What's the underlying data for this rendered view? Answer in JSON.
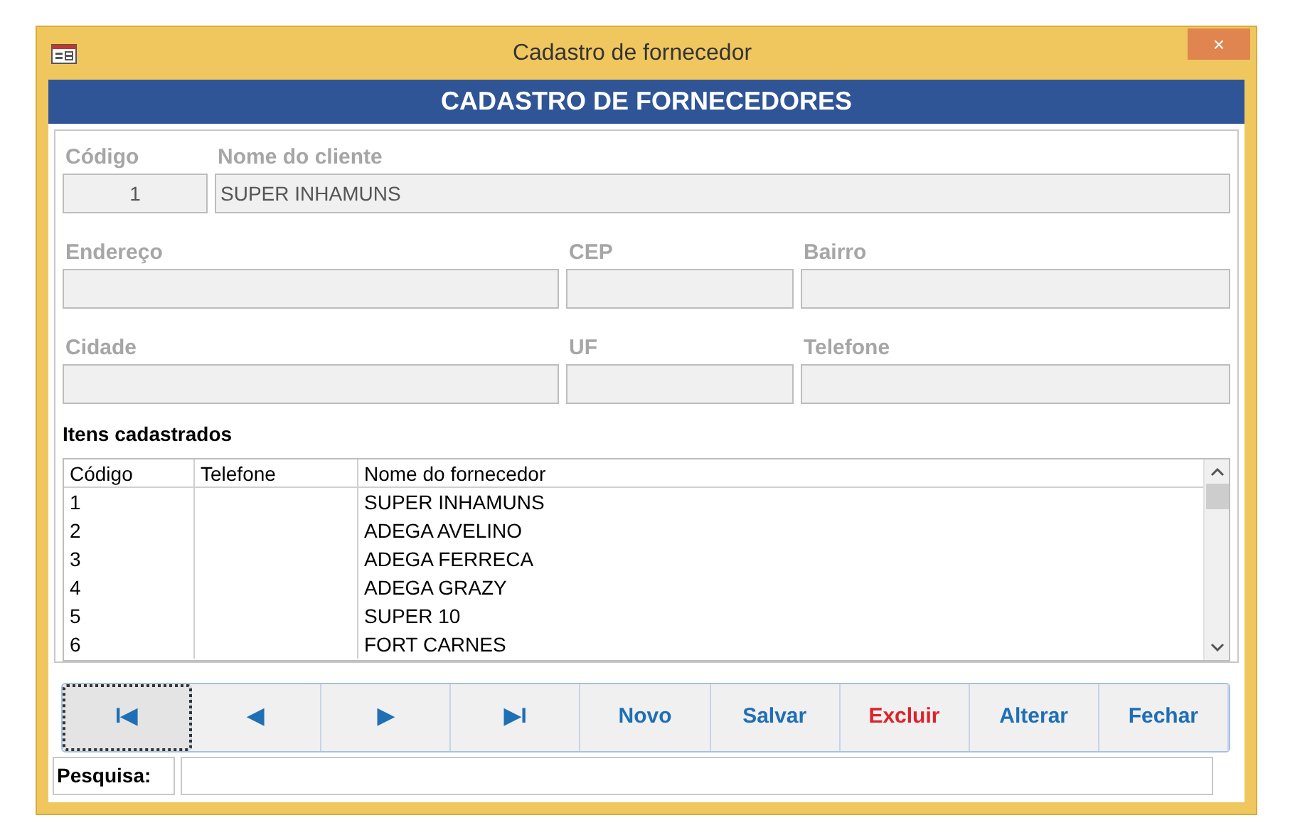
{
  "window": {
    "title": "Cadastro de fornecedor",
    "close": "×"
  },
  "header": "CADASTRO DE FORNECEDORES",
  "form": {
    "rows": [
      [
        {
          "label": "Código",
          "value": "1"
        },
        {
          "label": "Nome do cliente",
          "value": "SUPER INHAMUNS"
        }
      ],
      [
        {
          "label": "Endereço"
        },
        {
          "label": "CEP"
        },
        {
          "label": "Bairro"
        }
      ],
      [
        {
          "label": "Cidade"
        },
        {
          "label": "UF"
        },
        {
          "label": "Telefone"
        }
      ]
    ]
  },
  "list": {
    "title": "Itens cadastrados",
    "columns": [
      "Código",
      "Telefone",
      "Nome do fornecedor"
    ],
    "rows": [
      [
        "1",
        "",
        "SUPER INHAMUNS"
      ],
      [
        "2",
        "",
        "ADEGA AVELINO"
      ],
      [
        "3",
        "",
        "ADEGA FERRECA"
      ],
      [
        "4",
        "",
        "ADEGA GRAZY"
      ],
      [
        "5",
        "",
        "SUPER 10"
      ],
      [
        "6",
        "",
        "FORT CARNES"
      ]
    ]
  },
  "buttons": [
    {
      "label": "I◀",
      "color": "#1f6fb5",
      "focused": true
    },
    {
      "label": "◀",
      "color": "#1f6fb5",
      "focused": false
    },
    {
      "label": "▶",
      "color": "#1f6fb5",
      "focused": false
    },
    {
      "label": "▶I",
      "color": "#1f6fb5",
      "focused": false
    },
    {
      "label": "Novo",
      "color": "#1f6fb5",
      "focused": false
    },
    {
      "label": "Salvar",
      "color": "#1f6fb5",
      "focused": false
    },
    {
      "label": "Excluir",
      "color": "#e0202a",
      "focused": false
    },
    {
      "label": "Alterar",
      "color": "#1f6fb5",
      "focused": false
    },
    {
      "label": "Fechar",
      "color": "#1f6fb5",
      "focused": false
    }
  ],
  "search": {
    "label": "Pesquisa:"
  }
}
